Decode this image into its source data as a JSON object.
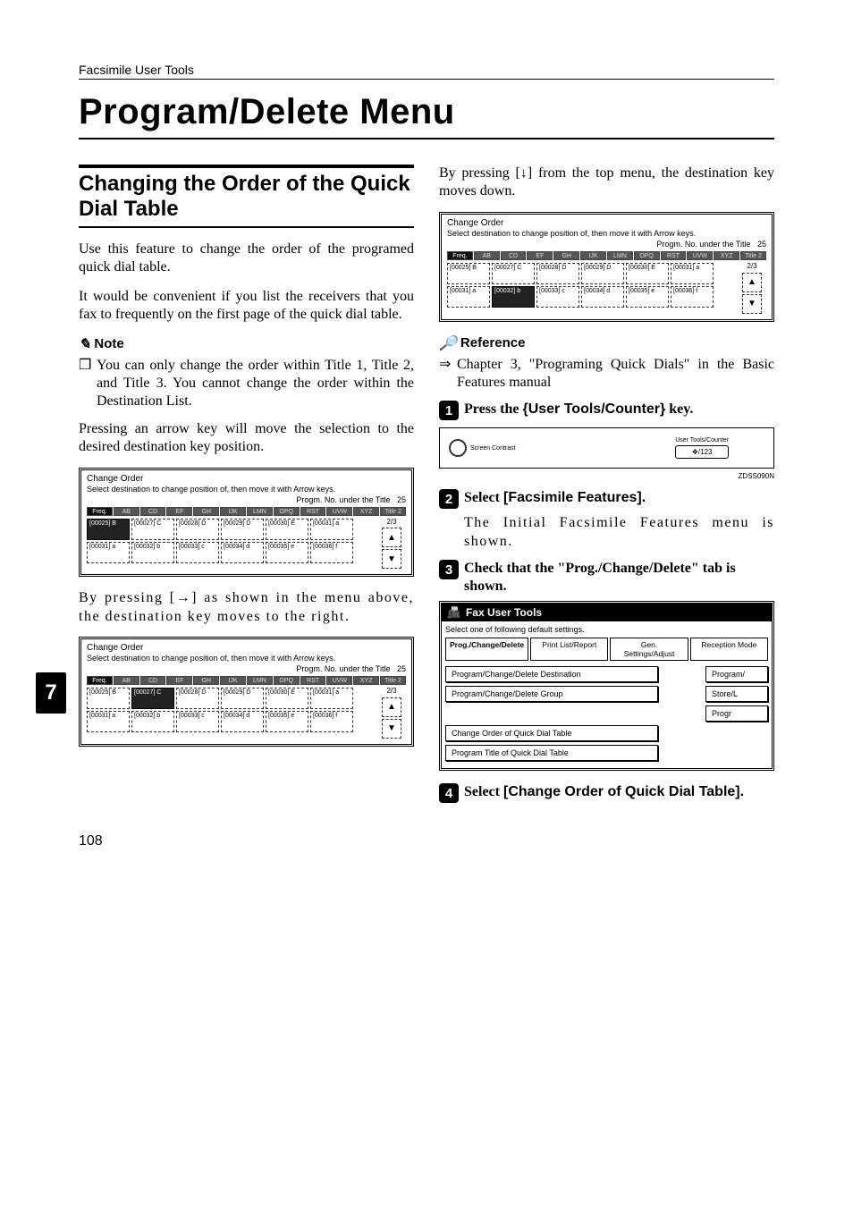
{
  "header": "Facsimile User Tools",
  "title": "Program/Delete Menu",
  "side_tab": "7",
  "page_number": "108",
  "left": {
    "h2": "Changing the Order of the Quick Dial Table",
    "p1": "Use this feature to change the order of the programed quick dial table.",
    "p2": "It would be convenient if you list the receivers that you fax to frequently on the first page of the quick dial table.",
    "note_label": "Note",
    "note_bullet": "You can only change the order within Title 1, Title 2, and Title 3. You cannot change the order within the Destination List.",
    "p3": "Pressing an arrow key will move the selection to the desired destination key position.",
    "p4_a": "By pressing ",
    "p4_key": "[→]",
    "p4_b": " as shown in the menu above, the destination key moves to the right."
  },
  "right": {
    "p1_a": "By pressing ",
    "p1_key": "[↓]",
    "p1_b": " from the top menu, the destination key moves down.",
    "ref_label": "Reference",
    "ref_text": "Chapter 3, \"Programing Quick Dials\" in the Basic Features manual",
    "step1_a": "Press the ",
    "step1_key": "{User Tools/Counter}",
    "step1_b": " key.",
    "panel_contrast": "Screen Contrast",
    "panel_btn": "User Tools/Counter",
    "panel_caption": "ZDSS090N",
    "step2_a": "Select ",
    "step2_key": "[Facsimile Features].",
    "step2_body": "The Initial Facsimile Features menu is shown.",
    "step3": "Check that the \"Prog./Change/Delete\" tab is shown.",
    "step4_a": "Select ",
    "step4_key": "[Change Order of Quick Dial Table]."
  },
  "change_order": {
    "title": "Change Order",
    "sub": "Select destination to change position of, then move it with Arrow keys.",
    "progm": "Progm. No. under the Title",
    "progm_n": "25",
    "freq": "Freq.",
    "page": "2/3",
    "tiles_row1": [
      "[00025]\nB",
      "[00027]\nC",
      "[00028]\nD",
      "[00029]\nD",
      "[00030]\nE",
      "[00031]\na"
    ],
    "tiles_row2": [
      "[00031]\na",
      "[00032]\nb",
      "[00033]\nc",
      "[00034]\nd",
      "[00035]\ne",
      "[00036]\nf"
    ],
    "hl_index_a": 0,
    "hl_index_b": 1,
    "hl_index_c": 7
  },
  "fax_tools": {
    "title": "Fax User Tools",
    "sub": "Select one of following default settings.",
    "tabs": [
      "Prog./Change/Delete",
      "Print List/Report",
      "Gen. Settings/Adjust",
      "Reception Mode"
    ],
    "btn1": "Program/Change/Delete Destination",
    "btn2": "Program/Change/Delete Group",
    "btn3": "Change Order of Quick Dial Table",
    "btn4": "Program Title of Quick Dial Table",
    "r1": "Program/",
    "r2": "Store/L",
    "r3": "Progr"
  }
}
